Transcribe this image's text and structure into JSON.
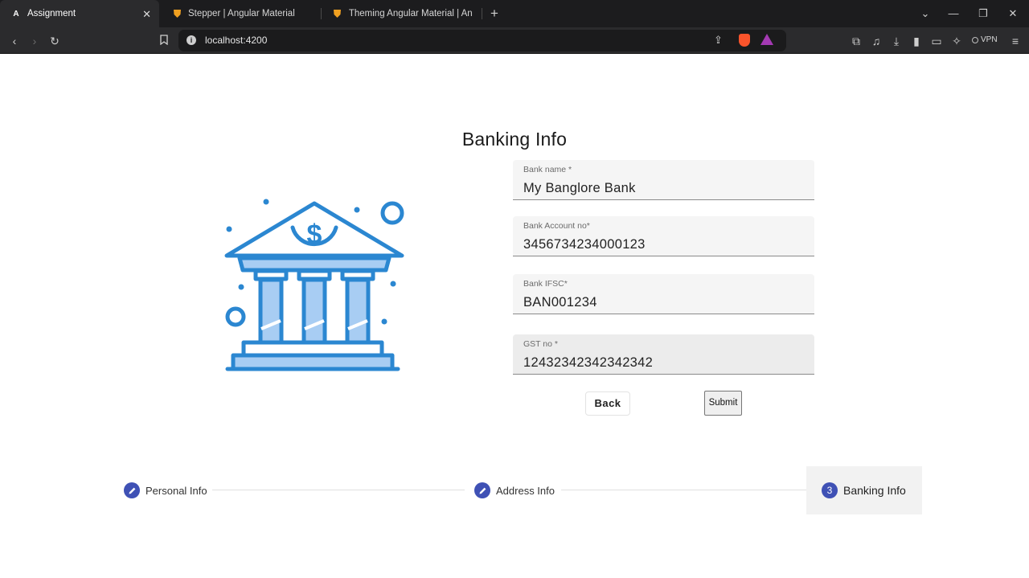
{
  "browser": {
    "tabs": [
      {
        "title": "Assignment",
        "icon": "angular-icon",
        "active": true
      },
      {
        "title": "Stepper | Angular Material",
        "icon": "brave-shield-icon",
        "active": false
      },
      {
        "title": "Theming Angular Material | Angular",
        "icon": "brave-shield-icon",
        "active": false
      }
    ],
    "url": "localhost:4200",
    "vpn_label": "VPN"
  },
  "page": {
    "title": "Banking Info"
  },
  "form": {
    "fields": [
      {
        "label": "Bank name *",
        "value": "My Banglore Bank"
      },
      {
        "label": "Bank Account no*",
        "value": "3456734234000123"
      },
      {
        "label": "Bank IFSC*",
        "value": "BAN001234"
      },
      {
        "label": "GST no *",
        "value": "12432342342342342"
      }
    ],
    "back_label": "Back",
    "submit_label": "Submit"
  },
  "stepper": {
    "steps": [
      {
        "label": "Personal Info",
        "state": "edit",
        "icon": "pencil-icon"
      },
      {
        "label": "Address Info",
        "state": "edit",
        "icon": "pencil-icon"
      },
      {
        "label": "Banking Info",
        "state": "active",
        "number": "3"
      }
    ]
  },
  "colors": {
    "accent": "#3f51b5",
    "illustration_stroke": "#2b87d1",
    "illustration_fill": "#a8cdf3"
  }
}
